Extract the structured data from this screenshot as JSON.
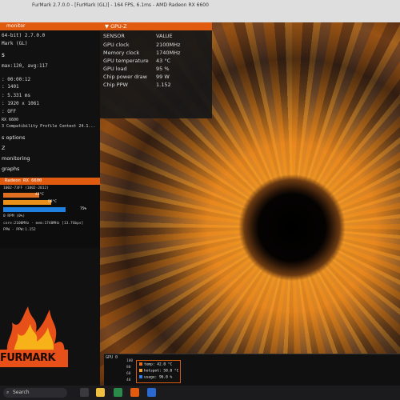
{
  "window": {
    "title": "FurMark 2.7.0.0 - [FurMark (GL)] - 164 FPS, 6.1ms - AMD Radeon RX 6600"
  },
  "left_panel": {
    "header": "monitor",
    "lines": [
      "64-bit) 2.7.0.0",
      "Mark (GL)",
      "S",
      "max:120, avg:117",
      ": 00:00:12",
      ": 1401",
      ": 5.331 ms",
      ": 1920 x 1061",
      ": OFF",
      "RX 6600",
      "3 Compatibility Profile Context 24.1..."
    ],
    "sections": [
      "s options",
      "Z",
      "monitoring",
      "graphs"
    ],
    "gpu": {
      "header": "Radeon RX 6600",
      "id_line": "1002-73FF (1002-2012)",
      "temp_label": "43°C",
      "hotspot_label": "58°C",
      "usage_label": "75%",
      "usage_text": "0 RPM (0%)",
      "temp_pct": 0.43,
      "hotspot_pct": 0.58,
      "usage_pct": 0.75,
      "clock_line": "core:2100MHz - mem:1740MHz [13.7Gbps]",
      "ppw_line": "PPW - PPW:1.152"
    },
    "logo_text": "FURMARK"
  },
  "gpuz": {
    "header": "GPU-Z",
    "col_sensor": "SENSOR",
    "col_value": "VALUE",
    "rows": [
      {
        "k": "GPU clock",
        "v": "2100MHz"
      },
      {
        "k": "Memory clock",
        "v": "1740MHz"
      },
      {
        "k": "GPU temperature",
        "v": "43 °C"
      },
      {
        "k": "GPU load",
        "v": "95 %"
      },
      {
        "k": "Chip power draw",
        "v": "99 W"
      },
      {
        "k": "Chip PPW",
        "v": "1.152"
      }
    ]
  },
  "graph": {
    "label": "GPU 0",
    "axis": [
      "100",
      "80",
      "60",
      "40"
    ],
    "legend": [
      {
        "label": "temp: 42.0 °C",
        "color": "#e07020"
      },
      {
        "label": "hotspot: 58.0 °C",
        "color": "#f0a030"
      },
      {
        "label": "usage: 96.0 %",
        "color": "#3080e0"
      }
    ]
  },
  "taskbar": {
    "search_label": "Search"
  },
  "colors": {
    "accent": "#e05a10",
    "usage_bar": "#2080e0"
  }
}
